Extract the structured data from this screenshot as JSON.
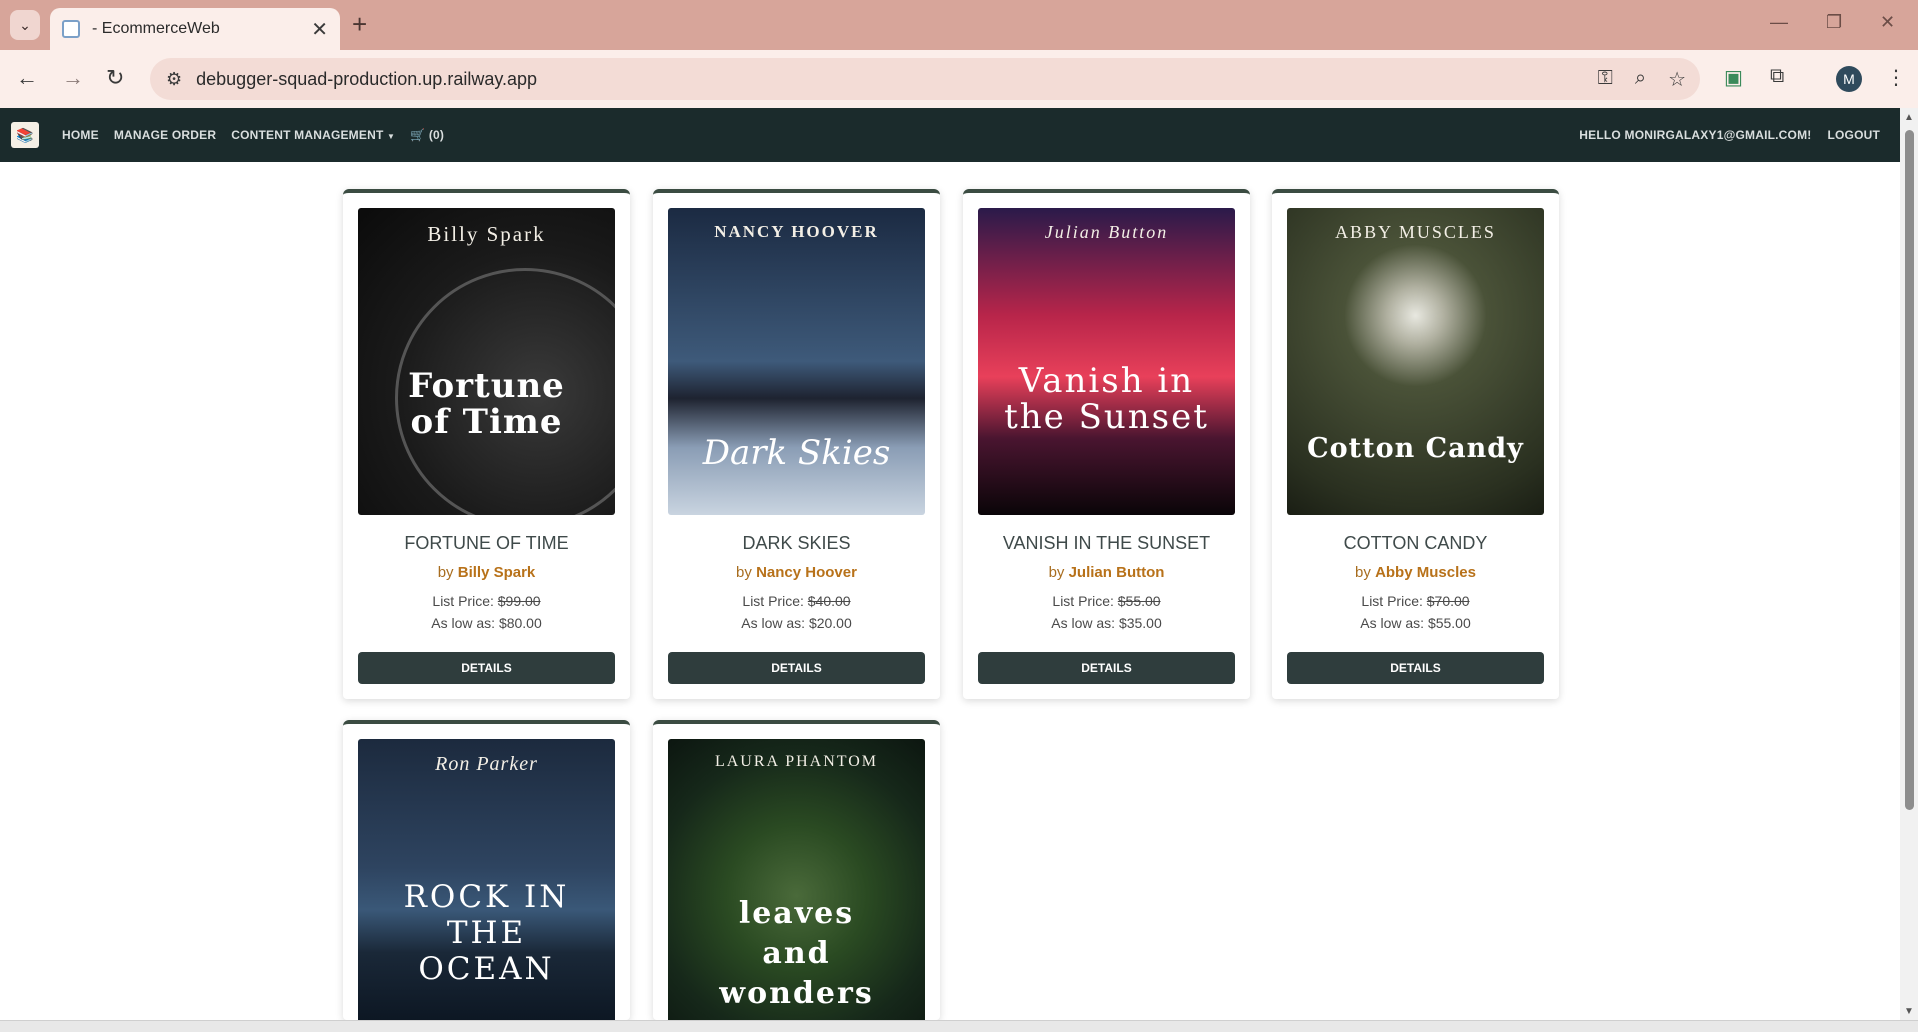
{
  "browser": {
    "tab_title": "- EcommerceWeb",
    "url": "debugger-squad-production.up.railway.app",
    "profile_initial": "M"
  },
  "nav": {
    "home": "HOME",
    "manage_order": "MANAGE ORDER",
    "content_management": "CONTENT MANAGEMENT",
    "cart_count": "(0)",
    "greeting": "HELLO MONIRGALAXY1@GMAIL.COM!",
    "logout": "LOGOUT"
  },
  "labels": {
    "by": "by",
    "list_price": "List Price:",
    "as_low_as": "As low as:",
    "details": "DETAILS"
  },
  "products": [
    {
      "title": "FORTUNE OF TIME",
      "author": "Billy Spark",
      "list_price": "$99.00",
      "low_price": "$80.00",
      "cover_author": "Billy Spark",
      "cover_title": "Fortune of Time"
    },
    {
      "title": "DARK SKIES",
      "author": "Nancy Hoover",
      "list_price": "$40.00",
      "low_price": "$20.00",
      "cover_author": "NANCY HOOVER",
      "cover_title": "Dark Skies"
    },
    {
      "title": "VANISH IN THE SUNSET",
      "author": "Julian Button",
      "list_price": "$55.00",
      "low_price": "$35.00",
      "cover_author": "Julian Button",
      "cover_title": "Vanish in the Sunset"
    },
    {
      "title": "COTTON CANDY",
      "author": "Abby Muscles",
      "list_price": "$70.00",
      "low_price": "$55.00",
      "cover_author": "ABBY MUSCLES",
      "cover_title": "Cotton Candy"
    },
    {
      "cover_author": "Ron Parker",
      "cover_title": "ROCK IN THE OCEAN"
    },
    {
      "cover_author": "LAURA PHANTOM",
      "cover_title": "leaves and wonders"
    }
  ]
}
